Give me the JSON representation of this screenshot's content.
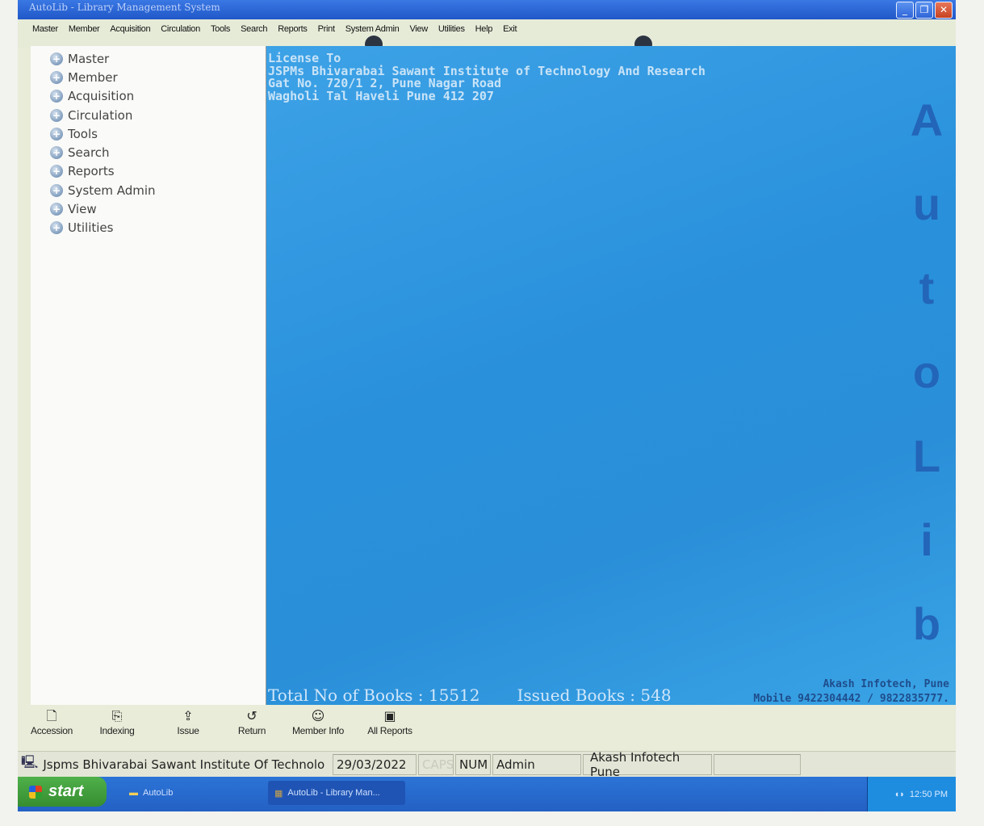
{
  "window": {
    "title": "AutoLib - Library Management System"
  },
  "menubar": [
    "Master",
    "Member",
    "Acquisition",
    "Circulation",
    "Tools",
    "Search",
    "Reports",
    "Print",
    "System Admin",
    "View",
    "Utilities",
    "Help",
    "Exit"
  ],
  "sidebar": {
    "items": [
      {
        "label": "Master"
      },
      {
        "label": "Member"
      },
      {
        "label": "Acquisition"
      },
      {
        "label": "Circulation"
      },
      {
        "label": "Tools"
      },
      {
        "label": "Search"
      },
      {
        "label": "Reports"
      },
      {
        "label": "System Admin"
      },
      {
        "label": "View"
      },
      {
        "label": "Utilities"
      }
    ]
  },
  "main": {
    "license": {
      "heading": "License To",
      "line1": "JSPMs Bhivarabai Sawant Institute of Technology And Research",
      "line2": "Gat No. 720/1 2, Pune Nagar Road",
      "line3": "Wagholi Tal Haveli Pune 412 207"
    },
    "brand_letters": [
      "A",
      "u",
      "t",
      "o",
      "L",
      "i",
      "b"
    ],
    "total_books": "Total No of Books : 15512",
    "issued_books": "Issued Books : 548",
    "vendor_name": "Akash Infotech, Pune",
    "vendor_mobile": "Mobile 9422304442 / 9822835777."
  },
  "toolbar": [
    {
      "label": "Accession",
      "icon": "page-icon"
    },
    {
      "label": "Indexing",
      "icon": "index-icon"
    },
    {
      "label": "Issue",
      "icon": "issue-icon"
    },
    {
      "label": "Return",
      "icon": "return-icon"
    },
    {
      "label": "Member Info",
      "icon": "member-icon"
    },
    {
      "label": "All Reports",
      "icon": "reports-icon"
    }
  ],
  "statusbar": {
    "institute": "Jspms Bhivarabai Sawant Institute Of Technolo",
    "date": "29/03/2022",
    "caps": "CAPS",
    "num": "NUM",
    "user": "Admin",
    "company": "Akash Infotech Pune",
    "empty": ""
  },
  "taskbar": {
    "start_label": "start",
    "folder_task": "AutoLib",
    "app_task": "AutoLib - Library Man...",
    "clock": "12:50 PM"
  }
}
